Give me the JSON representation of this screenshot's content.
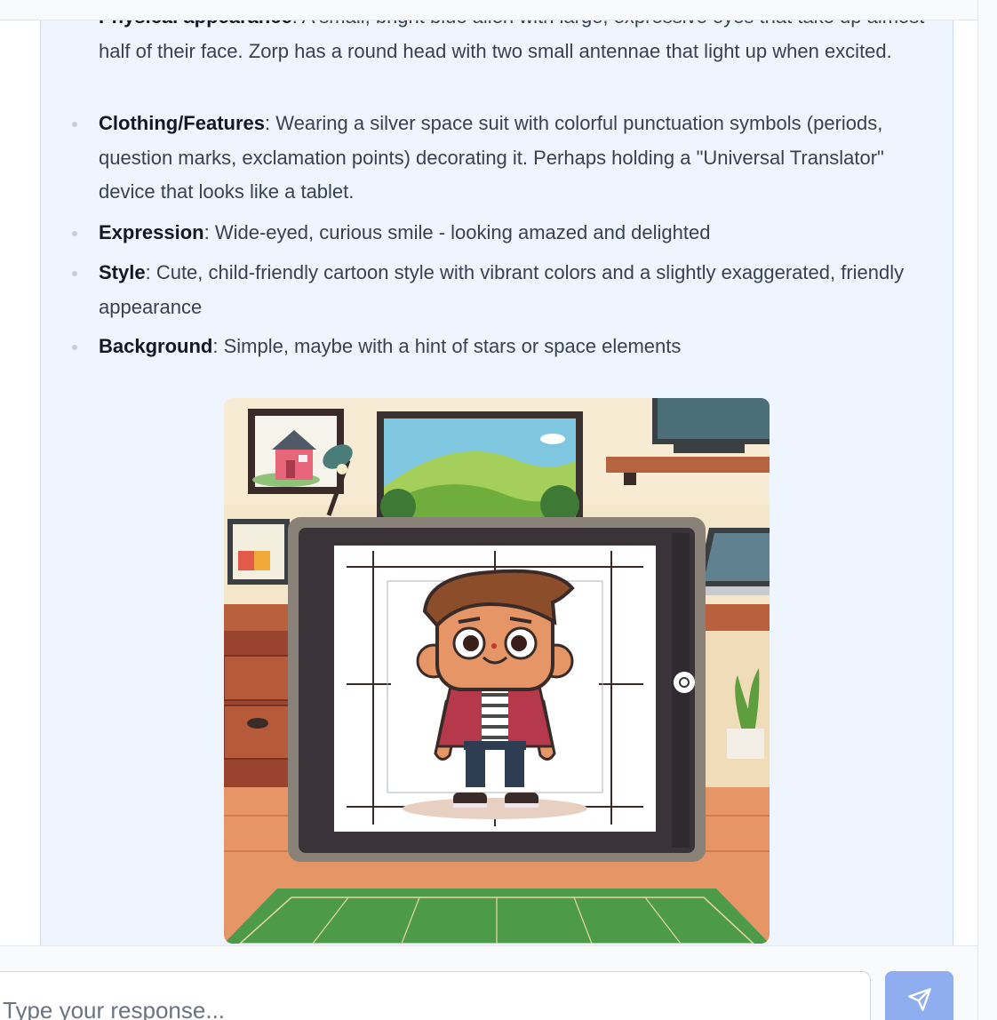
{
  "bullets": [
    {
      "label": "Physical appearance",
      "text": ": A small, bright blue alien with large, expressive eyes that take up almost half of their face. Zorp has a round head with two small antennae that light up when excited."
    },
    {
      "label": "Clothing/Features",
      "text": ": Wearing a silver space suit with colorful punctuation symbols (periods, question marks, exclamation points) decorating it. Perhaps holding a \"Universal Translator\" device that looks like a tablet."
    },
    {
      "label": "Expression",
      "text": ": Wide-eyed, curious smile - looking amazed and delighted"
    },
    {
      "label": "Style",
      "text": ": Cute, child-friendly cartoon style with vibrant colors and a slightly exaggerated, friendly appearance"
    },
    {
      "label": "Background",
      "text": ": Simple, maybe with a hint of stars or space elements"
    }
  ],
  "composer": {
    "placeholder": "Type your response...",
    "send_icon": "paper-plane-icon"
  },
  "colors": {
    "card_background": "#eef5fe",
    "send_button": "#8faef0",
    "bullet_text": "#374151",
    "bullet_label": "#111827"
  }
}
